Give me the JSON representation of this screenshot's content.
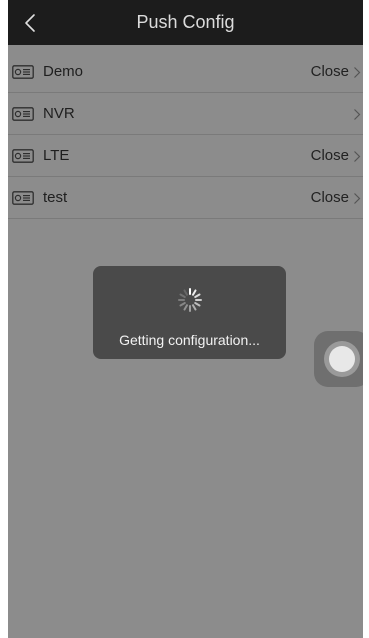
{
  "nav": {
    "title": "Push Config",
    "back_icon": "chevron-left-icon"
  },
  "devices": [
    {
      "name": "Demo",
      "status": "Close",
      "icon": "device-card-icon"
    },
    {
      "name": "NVR",
      "status": "",
      "icon": "device-card-icon"
    },
    {
      "name": "LTE",
      "status": "Close",
      "icon": "device-card-icon"
    },
    {
      "name": "test",
      "status": "Close",
      "icon": "device-card-icon"
    }
  ],
  "loading": {
    "message": "Getting configuration...",
    "icon": "spinner-icon"
  },
  "colors": {
    "nav_background": "#1c1c1c",
    "overlay": "#8c8c8c",
    "toast_background": "#4a4a4a"
  }
}
